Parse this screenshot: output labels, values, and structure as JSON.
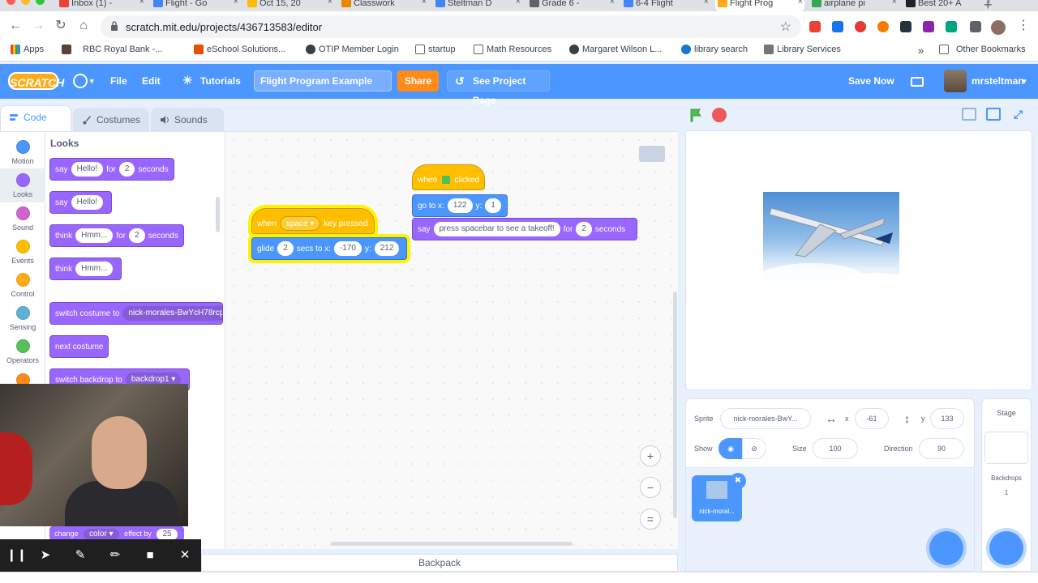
{
  "browser": {
    "tabs": [
      {
        "label": "Inbox (1) -",
        "color": "#ea4335",
        "active": false
      },
      {
        "label": "Flight - Go",
        "color": "#4285f4",
        "active": false
      },
      {
        "label": "Oct 15, 20",
        "color": "#fbbc04",
        "active": false
      },
      {
        "label": "Classwork",
        "color": "#ea8600",
        "active": false
      },
      {
        "label": "Steltman D",
        "color": "#4285f4",
        "active": false
      },
      {
        "label": "Grade 6 -",
        "color": "#5f6368",
        "active": false
      },
      {
        "label": "6-4 Flight",
        "color": "#4285f4",
        "active": false
      },
      {
        "label": "Flight Prog",
        "color": "#ffab19",
        "active": true
      },
      {
        "label": "airplane pi",
        "color": "#34a853",
        "active": false
      },
      {
        "label": "Best 20+ A",
        "color": "#202124",
        "active": false
      }
    ],
    "url": "scratch.mit.edu/projects/436713583/editor",
    "bookmarks": [
      "Apps",
      "RBC Royal Bank -...",
      "eSchool Solutions...",
      "OTIP Member Login",
      "startup",
      "Math Resources",
      "Margaret Wilson L...",
      "library search",
      "Library Services",
      "Other Bookmarks"
    ]
  },
  "menubar": {
    "logo": "SCRATCH",
    "file": "File",
    "edit": "Edit",
    "tutorials": "Tutorials",
    "project_title": "Flight Program Example",
    "share": "Share",
    "see_project": "See Project Page",
    "save_now": "Save Now",
    "username": "mrsteltman"
  },
  "editor_tabs": {
    "code": "Code",
    "costumes": "Costumes",
    "sounds": "Sounds"
  },
  "categories": [
    {
      "label": "Motion",
      "color": "#4c97ff"
    },
    {
      "label": "Looks",
      "color": "#9966ff"
    },
    {
      "label": "Sound",
      "color": "#cf63cf"
    },
    {
      "label": "Events",
      "color": "#ffbf00"
    },
    {
      "label": "Control",
      "color": "#ffab19"
    },
    {
      "label": "Sensing",
      "color": "#5cb1d6"
    },
    {
      "label": "Operators",
      "color": "#59c059"
    }
  ],
  "palette": {
    "section_title": "Looks",
    "say_for": {
      "say": "say",
      "text": "Hello!",
      "for": "for",
      "secs": "2",
      "seconds": "seconds"
    },
    "say": {
      "say": "say",
      "text": "Hello!"
    },
    "think_for": {
      "think": "think",
      "text": "Hmm...",
      "for": "for",
      "secs": "2",
      "seconds": "seconds"
    },
    "think": {
      "think": "think",
      "text": "Hmm..."
    },
    "switch_costume": {
      "label": "switch costume to",
      "value": "nick-morales-BwYcH78rcp"
    },
    "next_costume": "next costume",
    "switch_backdrop": {
      "label": "switch backdrop to",
      "value": "backdrop1"
    },
    "change_effect": {
      "change": "change",
      "effect": "color",
      "by": "effect by",
      "value": "25"
    }
  },
  "scripts": {
    "key_script": {
      "when": "when",
      "key": "space",
      "pressed": "key pressed",
      "glide": "glide",
      "secs": "2",
      "secs_to_x": "secs to x:",
      "x": "-170",
      "y_label": "y:",
      "y": "212"
    },
    "flag_script": {
      "when": "when",
      "clicked": "clicked",
      "goto": "go to x:",
      "x": "122",
      "y_label": "y:",
      "y": "1",
      "say": "say",
      "message": "press spacebar to see a takeoff!",
      "for": "for",
      "secs": "2",
      "seconds": "seconds"
    }
  },
  "backpack": "Backpack",
  "sprite_info": {
    "sprite_label": "Sprite",
    "sprite_name": "nick-morales-BwY...",
    "x_label": "x",
    "x": "-61",
    "y_label": "y",
    "y": "133",
    "show_label": "Show",
    "size_label": "Size",
    "size": "100",
    "direction_label": "Direction",
    "direction": "90"
  },
  "sprite_list": [
    {
      "name": "nick-moral..."
    }
  ],
  "stage_pane": {
    "title": "Stage",
    "backdrops_label": "Backdrops",
    "backdrops_count": "1"
  }
}
